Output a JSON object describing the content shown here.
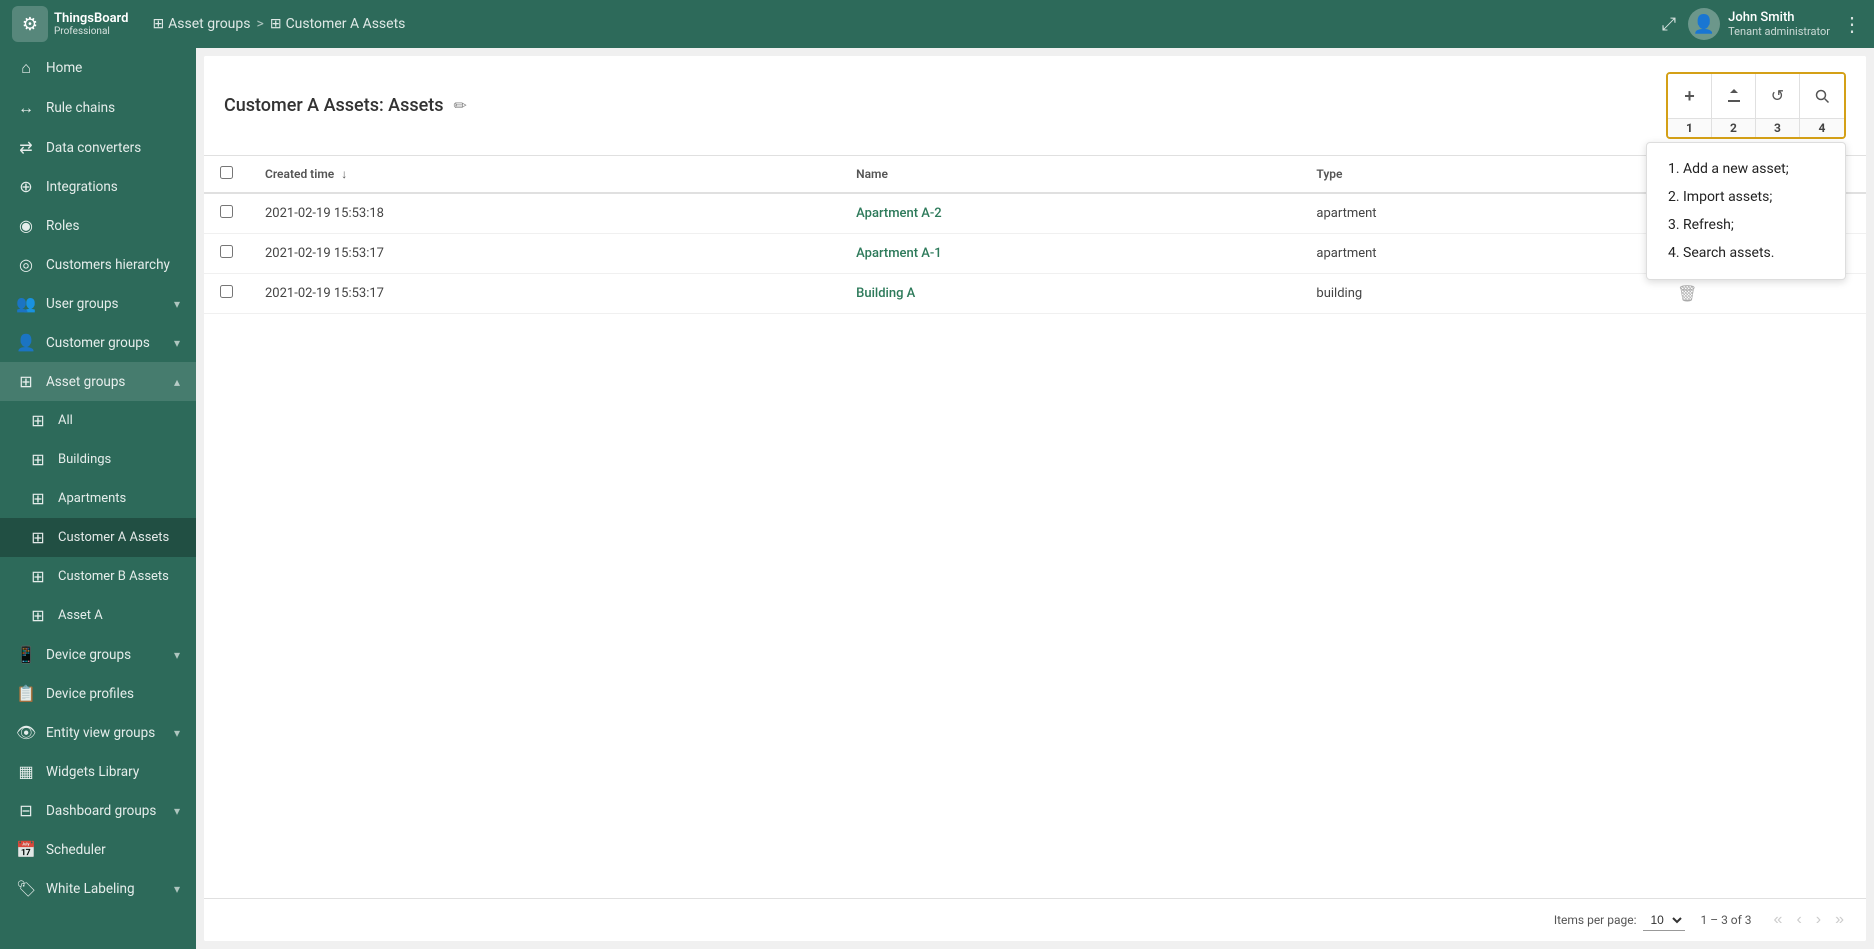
{
  "topbar": {
    "logo_icon": "⚙",
    "logo_text": "ThingsBoard",
    "logo_sub": "Professional",
    "breadcrumb": [
      {
        "icon": "⊞",
        "label": "Asset groups"
      },
      {
        "icon": "⊞",
        "label": "Customer A Assets"
      }
    ],
    "user_name": "John Smith",
    "user_role": "Tenant administrator",
    "expand_icon": "⤢",
    "menu_icon": "⋮"
  },
  "sidebar": {
    "items": [
      {
        "id": "home",
        "icon": "⌂",
        "label": "Home",
        "active": false,
        "indent": false
      },
      {
        "id": "rule-chains",
        "icon": "↔",
        "label": "Rule chains",
        "active": false,
        "indent": false
      },
      {
        "id": "data-converters",
        "icon": "⇄",
        "label": "Data converters",
        "active": false,
        "indent": false
      },
      {
        "id": "integrations",
        "icon": "⊕",
        "label": "Integrations",
        "active": false,
        "indent": false
      },
      {
        "id": "roles",
        "icon": "◉",
        "label": "Roles",
        "active": false,
        "indent": false
      },
      {
        "id": "customers-hierarchy",
        "icon": "◎",
        "label": "Customers hierarchy",
        "active": false,
        "indent": false
      },
      {
        "id": "user-groups",
        "icon": "👥",
        "label": "User groups",
        "active": false,
        "indent": false,
        "chevron": "▾"
      },
      {
        "id": "customer-groups",
        "icon": "👤",
        "label": "Customer groups",
        "active": false,
        "indent": false,
        "chevron": "▾"
      },
      {
        "id": "asset-groups",
        "icon": "⊞",
        "label": "Asset groups",
        "active": true,
        "indent": false,
        "chevron": "▴"
      },
      {
        "id": "all",
        "icon": "⊞",
        "label": "All",
        "active": false,
        "indent": true
      },
      {
        "id": "buildings",
        "icon": "⊞",
        "label": "Buildings",
        "active": false,
        "indent": true
      },
      {
        "id": "apartments",
        "icon": "⊞",
        "label": "Apartments",
        "active": false,
        "indent": true
      },
      {
        "id": "customer-a-assets",
        "icon": "⊞",
        "label": "Customer A Assets",
        "active": true,
        "indent": true
      },
      {
        "id": "customer-b-assets",
        "icon": "⊞",
        "label": "Customer B Assets",
        "active": false,
        "indent": true
      },
      {
        "id": "asset-a",
        "icon": "⊞",
        "label": "Asset A",
        "active": false,
        "indent": true
      },
      {
        "id": "device-groups",
        "icon": "📱",
        "label": "Device groups",
        "active": false,
        "indent": false,
        "chevron": "▾"
      },
      {
        "id": "device-profiles",
        "icon": "📋",
        "label": "Device profiles",
        "active": false,
        "indent": false
      },
      {
        "id": "entity-view-groups",
        "icon": "👁",
        "label": "Entity view groups",
        "active": false,
        "indent": false,
        "chevron": "▾"
      },
      {
        "id": "widgets-library",
        "icon": "▦",
        "label": "Widgets Library",
        "active": false,
        "indent": false
      },
      {
        "id": "dashboard-groups",
        "icon": "⊟",
        "label": "Dashboard groups",
        "active": false,
        "indent": false,
        "chevron": "▾"
      },
      {
        "id": "scheduler",
        "icon": "📅",
        "label": "Scheduler",
        "active": false,
        "indent": false
      },
      {
        "id": "white-labeling",
        "icon": "🏷",
        "label": "White Labeling",
        "active": false,
        "indent": false,
        "chevron": "▾"
      }
    ]
  },
  "page": {
    "title": "Customer A Assets: Assets",
    "edit_icon": "✏"
  },
  "toolbar": {
    "buttons": [
      {
        "id": "add",
        "icon": "+",
        "num": "1",
        "title": "Add a new asset"
      },
      {
        "id": "import",
        "icon": "↑",
        "num": "2",
        "title": "Import assets"
      },
      {
        "id": "refresh",
        "icon": "↺",
        "num": "3",
        "title": "Refresh"
      },
      {
        "id": "search",
        "icon": "🔍",
        "num": "4",
        "title": "Search assets"
      }
    ]
  },
  "callout": {
    "items": [
      "Add a new asset;",
      "Import assets;",
      "Refresh;",
      "Search assets."
    ]
  },
  "table": {
    "columns": [
      {
        "id": "created",
        "label": "Created time",
        "sortable": true,
        "sort_dir": "↓"
      },
      {
        "id": "name",
        "label": "Name",
        "sortable": false
      },
      {
        "id": "type",
        "label": "Type",
        "sortable": false
      }
    ],
    "rows": [
      {
        "id": "1",
        "created": "2021-02-19 15:53:18",
        "name": "Apartment A-2",
        "type": "apartment"
      },
      {
        "id": "2",
        "created": "2021-02-19 15:53:17",
        "name": "Apartment A-1",
        "type": "apartment"
      },
      {
        "id": "3",
        "created": "2021-02-19 15:53:17",
        "name": "Building A",
        "type": "building"
      }
    ]
  },
  "footer": {
    "items_per_page_label": "Items per page:",
    "items_per_page_value": "10",
    "pagination_info": "1 – 3 of 3",
    "first_page": "«",
    "prev_page": "‹",
    "next_page": "›",
    "last_page": "»"
  }
}
